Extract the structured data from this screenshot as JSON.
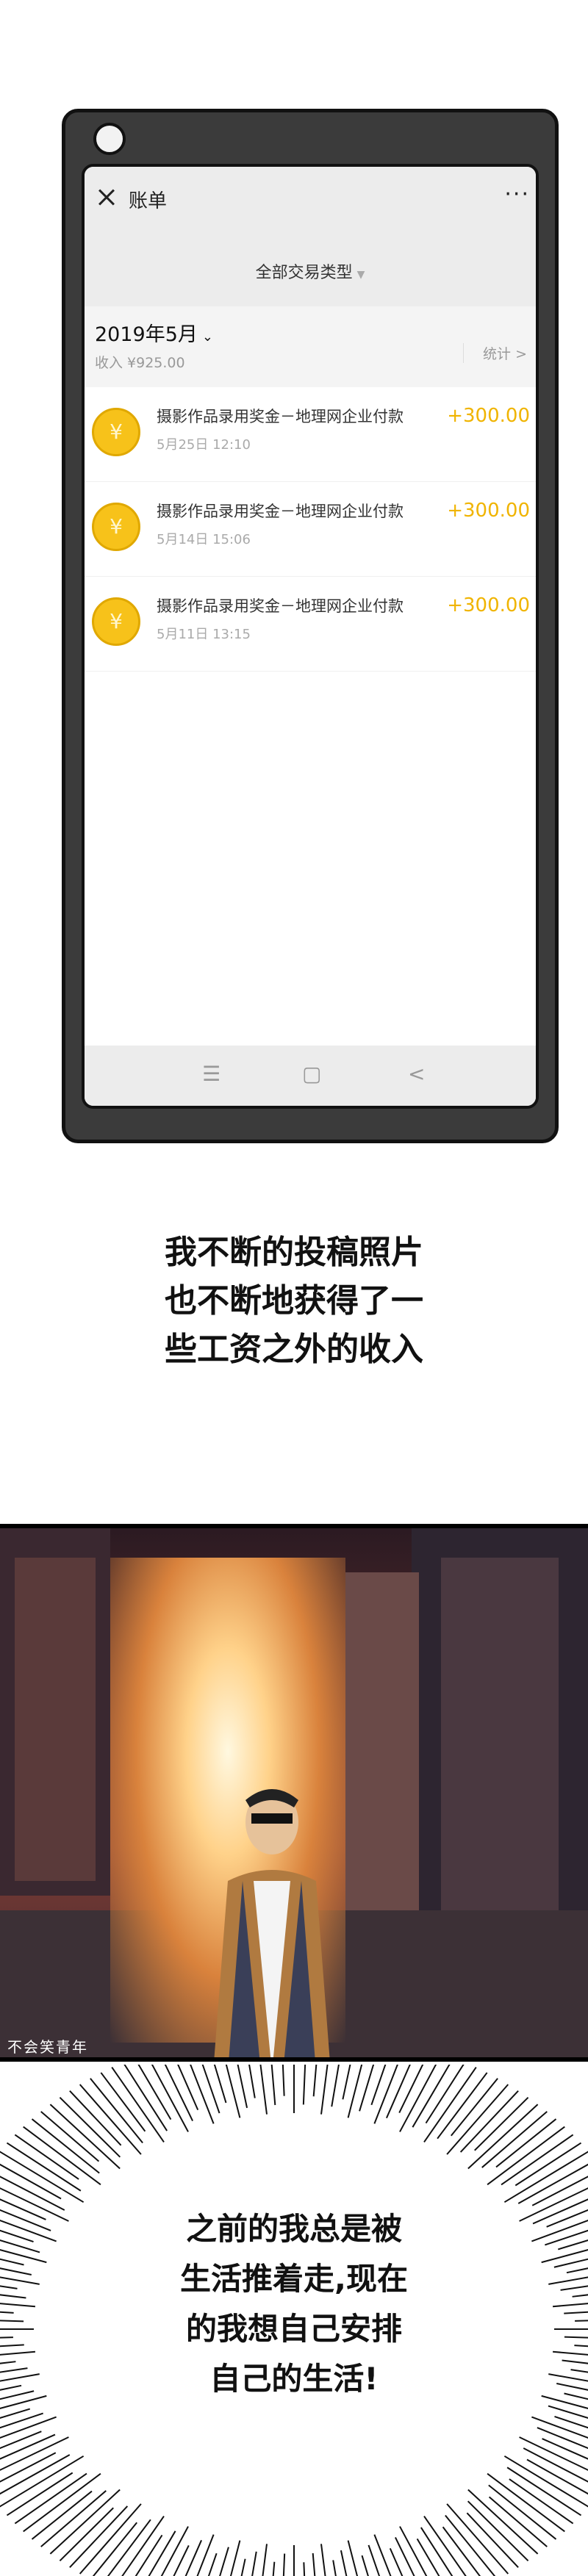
{
  "phone": {
    "title": "账单",
    "more": "···",
    "filter": "全部交易类型",
    "month": "2019年5月",
    "income": "收入 ¥925.00",
    "stats": "统计 >",
    "transactions": [
      {
        "title": "摄影作品录用奖金－地理网企业付款",
        "date": "5月25日 12:10",
        "amount": "+300.00"
      },
      {
        "title": "摄影作品录用奖金－地理网企业付款",
        "date": "5月14日 15:06",
        "amount": "+300.00"
      },
      {
        "title": "摄影作品录用奖金－地理网企业付款",
        "date": "5月11日 13:15",
        "amount": "+300.00"
      }
    ],
    "nav": {
      "menu": "☰",
      "home": "▢",
      "back": "<"
    }
  },
  "caption1": [
    "我不断的投稿照片",
    "也不断地获得了一",
    "些工资之外的收入"
  ],
  "panel": {
    "watermark": "不会笑青年"
  },
  "caption2": [
    "之前的我总是被",
    "生活推着走,现在",
    "的我想自己安排",
    "自己的生活!"
  ],
  "colors": {
    "coin": "#f7c21a",
    "amount": "#f0b400",
    "phone_body": "#3b3b3b"
  }
}
